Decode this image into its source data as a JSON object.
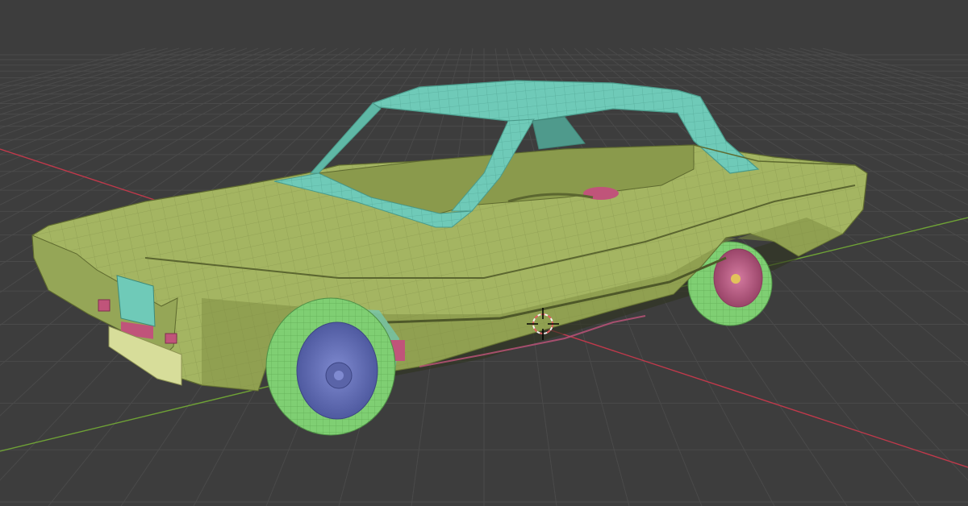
{
  "viewport": {
    "mode": "3d-viewport",
    "colors": {
      "background": "#3d3d3d",
      "grid_line": "#4a4a4a",
      "axis_x": "#c0394b",
      "axis_y": "#6fa236",
      "body_paint": "#a4b562",
      "body_shadow": "#6f7d3a",
      "roof_glass_trim": "#6fcab8",
      "tire": "#7fcf73",
      "rim_front": "#6470b9",
      "rim_rear": "#bd5d86",
      "interior_accent": "#c0547a",
      "wire": "#5e6a2f"
    },
    "icons": [
      "3d-cursor-icon"
    ],
    "object": "car-mesh"
  }
}
